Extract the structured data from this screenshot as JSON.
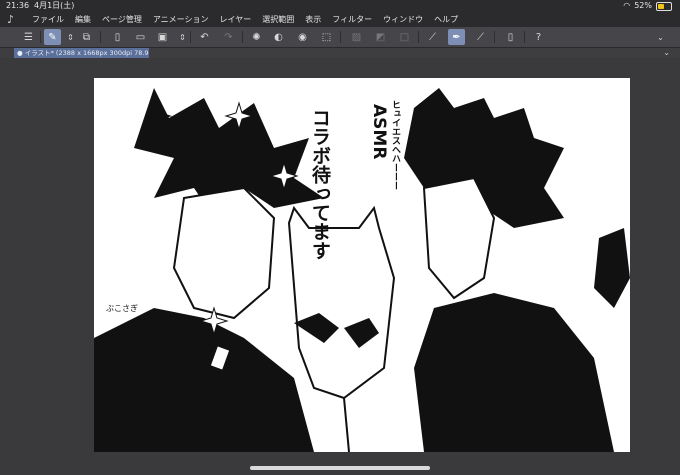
{
  "status_bar": {
    "time": "21:36",
    "date": "4月1日(土)",
    "battery_text": "52%",
    "battery_level": 0.52,
    "battery_color": "#f2c21b"
  },
  "menu": {
    "app_icon": "csp-app-icon",
    "items": [
      "ファイル",
      "編集",
      "ページ管理",
      "アニメーション",
      "レイヤー",
      "選択範囲",
      "表示",
      "フィルター",
      "ウィンドウ",
      "ヘルプ"
    ]
  },
  "toolbar": {
    "icons": [
      "menu-icon",
      "edit-mode-icon",
      "stepper-icon",
      "copy-icon",
      "new-file-icon",
      "open-file-icon",
      "save-icon",
      "export-icon",
      "stepper-icon",
      "undo-icon",
      "redo-icon",
      "busy-spinner-icon",
      "clear-icon",
      "fill-icon",
      "transform-icon",
      "deselect-icon",
      "invert-selection-icon",
      "selection-box-icon",
      "ruler-snap-icon",
      "pen-tool-icon",
      "line-tool-icon",
      "device-icon",
      "help-icon"
    ]
  },
  "document_tab": {
    "label": "● イラスト* (2388 x 1668px 300dpi 78.9%)"
  },
  "artwork": {
    "text_main": "コラボ待ってます",
    "text_asmr": "ASMR",
    "text_small": "ヒュイエスへハーーー",
    "signature": "ぶこさぎ"
  },
  "colors": {
    "accent": "#7d8fb5",
    "tab": "#5a6f9a",
    "background": "#3a3a3c"
  }
}
